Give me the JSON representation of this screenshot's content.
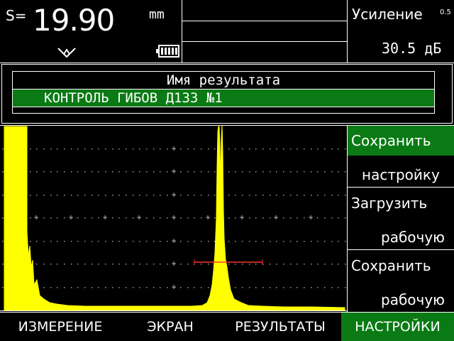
{
  "header": {
    "thickness_label": "S=",
    "thickness_value": "19.90",
    "thickness_unit": "mm",
    "gain_label": "Усиление",
    "gain_step": "0.5",
    "gain_value": "30.5 дБ"
  },
  "dialog": {
    "title": "Имя результата",
    "name_value": "КОНТРОЛЬ ГИБОВ Д133 №1"
  },
  "side_menu": {
    "items": [
      {
        "line1": "Сохранить",
        "line2": "настройку"
      },
      {
        "line1": "Загрузить",
        "line2": "рабочую"
      },
      {
        "line1": "Сохранить",
        "line2": "рабочую"
      }
    ]
  },
  "tabs": [
    "ИЗМЕРЕНИЕ",
    "ЭКРАН",
    "РЕЗУЛЬТАТЫ",
    "НАСТРОЙКИ"
  ],
  "colors": {
    "accent_green": "#0a7a14",
    "signal_yellow": "#ffff00",
    "gate_red": "#ff3030"
  },
  "icons": [
    "probe-icon",
    "battery-icon"
  ]
}
